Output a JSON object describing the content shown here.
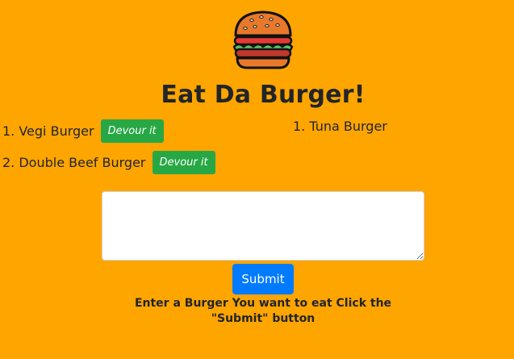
{
  "header": {
    "logo_icon": "burger-icon",
    "title": "Eat Da Burger!"
  },
  "burgers": [
    {
      "label": "1. Vegi Burger",
      "button": "Devour it"
    },
    {
      "label": "2. Double Beef Burger",
      "button": "Devour it"
    }
  ],
  "devoured": [
    {
      "label": "1. Tuna Burger"
    }
  ],
  "form": {
    "textarea_value": "",
    "submit_label": "Submit",
    "instructions": "Enter a Burger You want to eat Click the \"Submit\" button"
  },
  "colors": {
    "background": "#ffa500",
    "devour_button": "#28a745",
    "submit_button": "#007bff"
  }
}
